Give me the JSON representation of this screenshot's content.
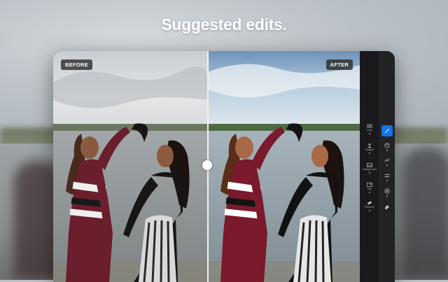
{
  "headline": "Suggested edits.",
  "badges": {
    "before": "BEFORE",
    "after": "AFTER"
  },
  "tools_left": [
    {
      "label": "Auto",
      "icon": "sliders-auto-icon"
    },
    {
      "label": "Subject",
      "icon": "person-icon"
    },
    {
      "label": "Background",
      "icon": "landscape-icon"
    },
    {
      "label": "Sky",
      "icon": "sky-icon"
    },
    {
      "label": "Retouch",
      "icon": "bandage-icon"
    }
  ],
  "tools_right": [
    {
      "icon": "magic-wand-icon",
      "active": true
    },
    {
      "icon": "color-palette-icon",
      "active": false
    },
    {
      "icon": "curves-icon",
      "active": false
    },
    {
      "icon": "adjust-sliders-icon",
      "active": false
    },
    {
      "icon": "lens-icon",
      "active": false
    },
    {
      "icon": "eraser-icon",
      "active": false
    }
  ],
  "colors": {
    "accent": "#1473e6",
    "panel": "#1d1d1f"
  }
}
